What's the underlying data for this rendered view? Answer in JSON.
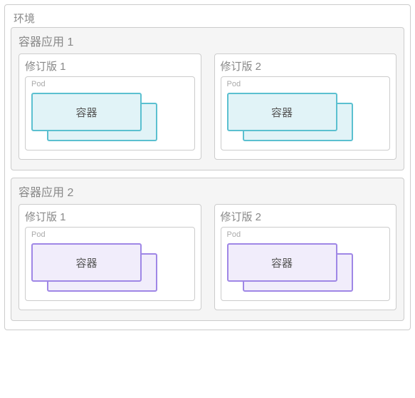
{
  "environment": {
    "label": "环境",
    "apps": [
      {
        "label": "容器应用 1",
        "color_scheme": "teal",
        "revisions": [
          {
            "label": "修订版 1",
            "pod_label": "Pod",
            "container_label": "容器"
          },
          {
            "label": "修订版 2",
            "pod_label": "Pod",
            "container_label": "容器"
          }
        ]
      },
      {
        "label": "容器应用 2",
        "color_scheme": "purple",
        "revisions": [
          {
            "label": "修订版 1",
            "pod_label": "Pod",
            "container_label": "容器"
          },
          {
            "label": "修订版 2",
            "pod_label": "Pod",
            "container_label": "容器"
          }
        ]
      }
    ]
  },
  "colors": {
    "teal_border": "#5bc0d0",
    "teal_fill": "#e1f3f7",
    "purple_border": "#9f87e6",
    "purple_fill": "#f1edfb",
    "gray_border": "#cccccc",
    "gray_fill": "#f5f5f5"
  }
}
